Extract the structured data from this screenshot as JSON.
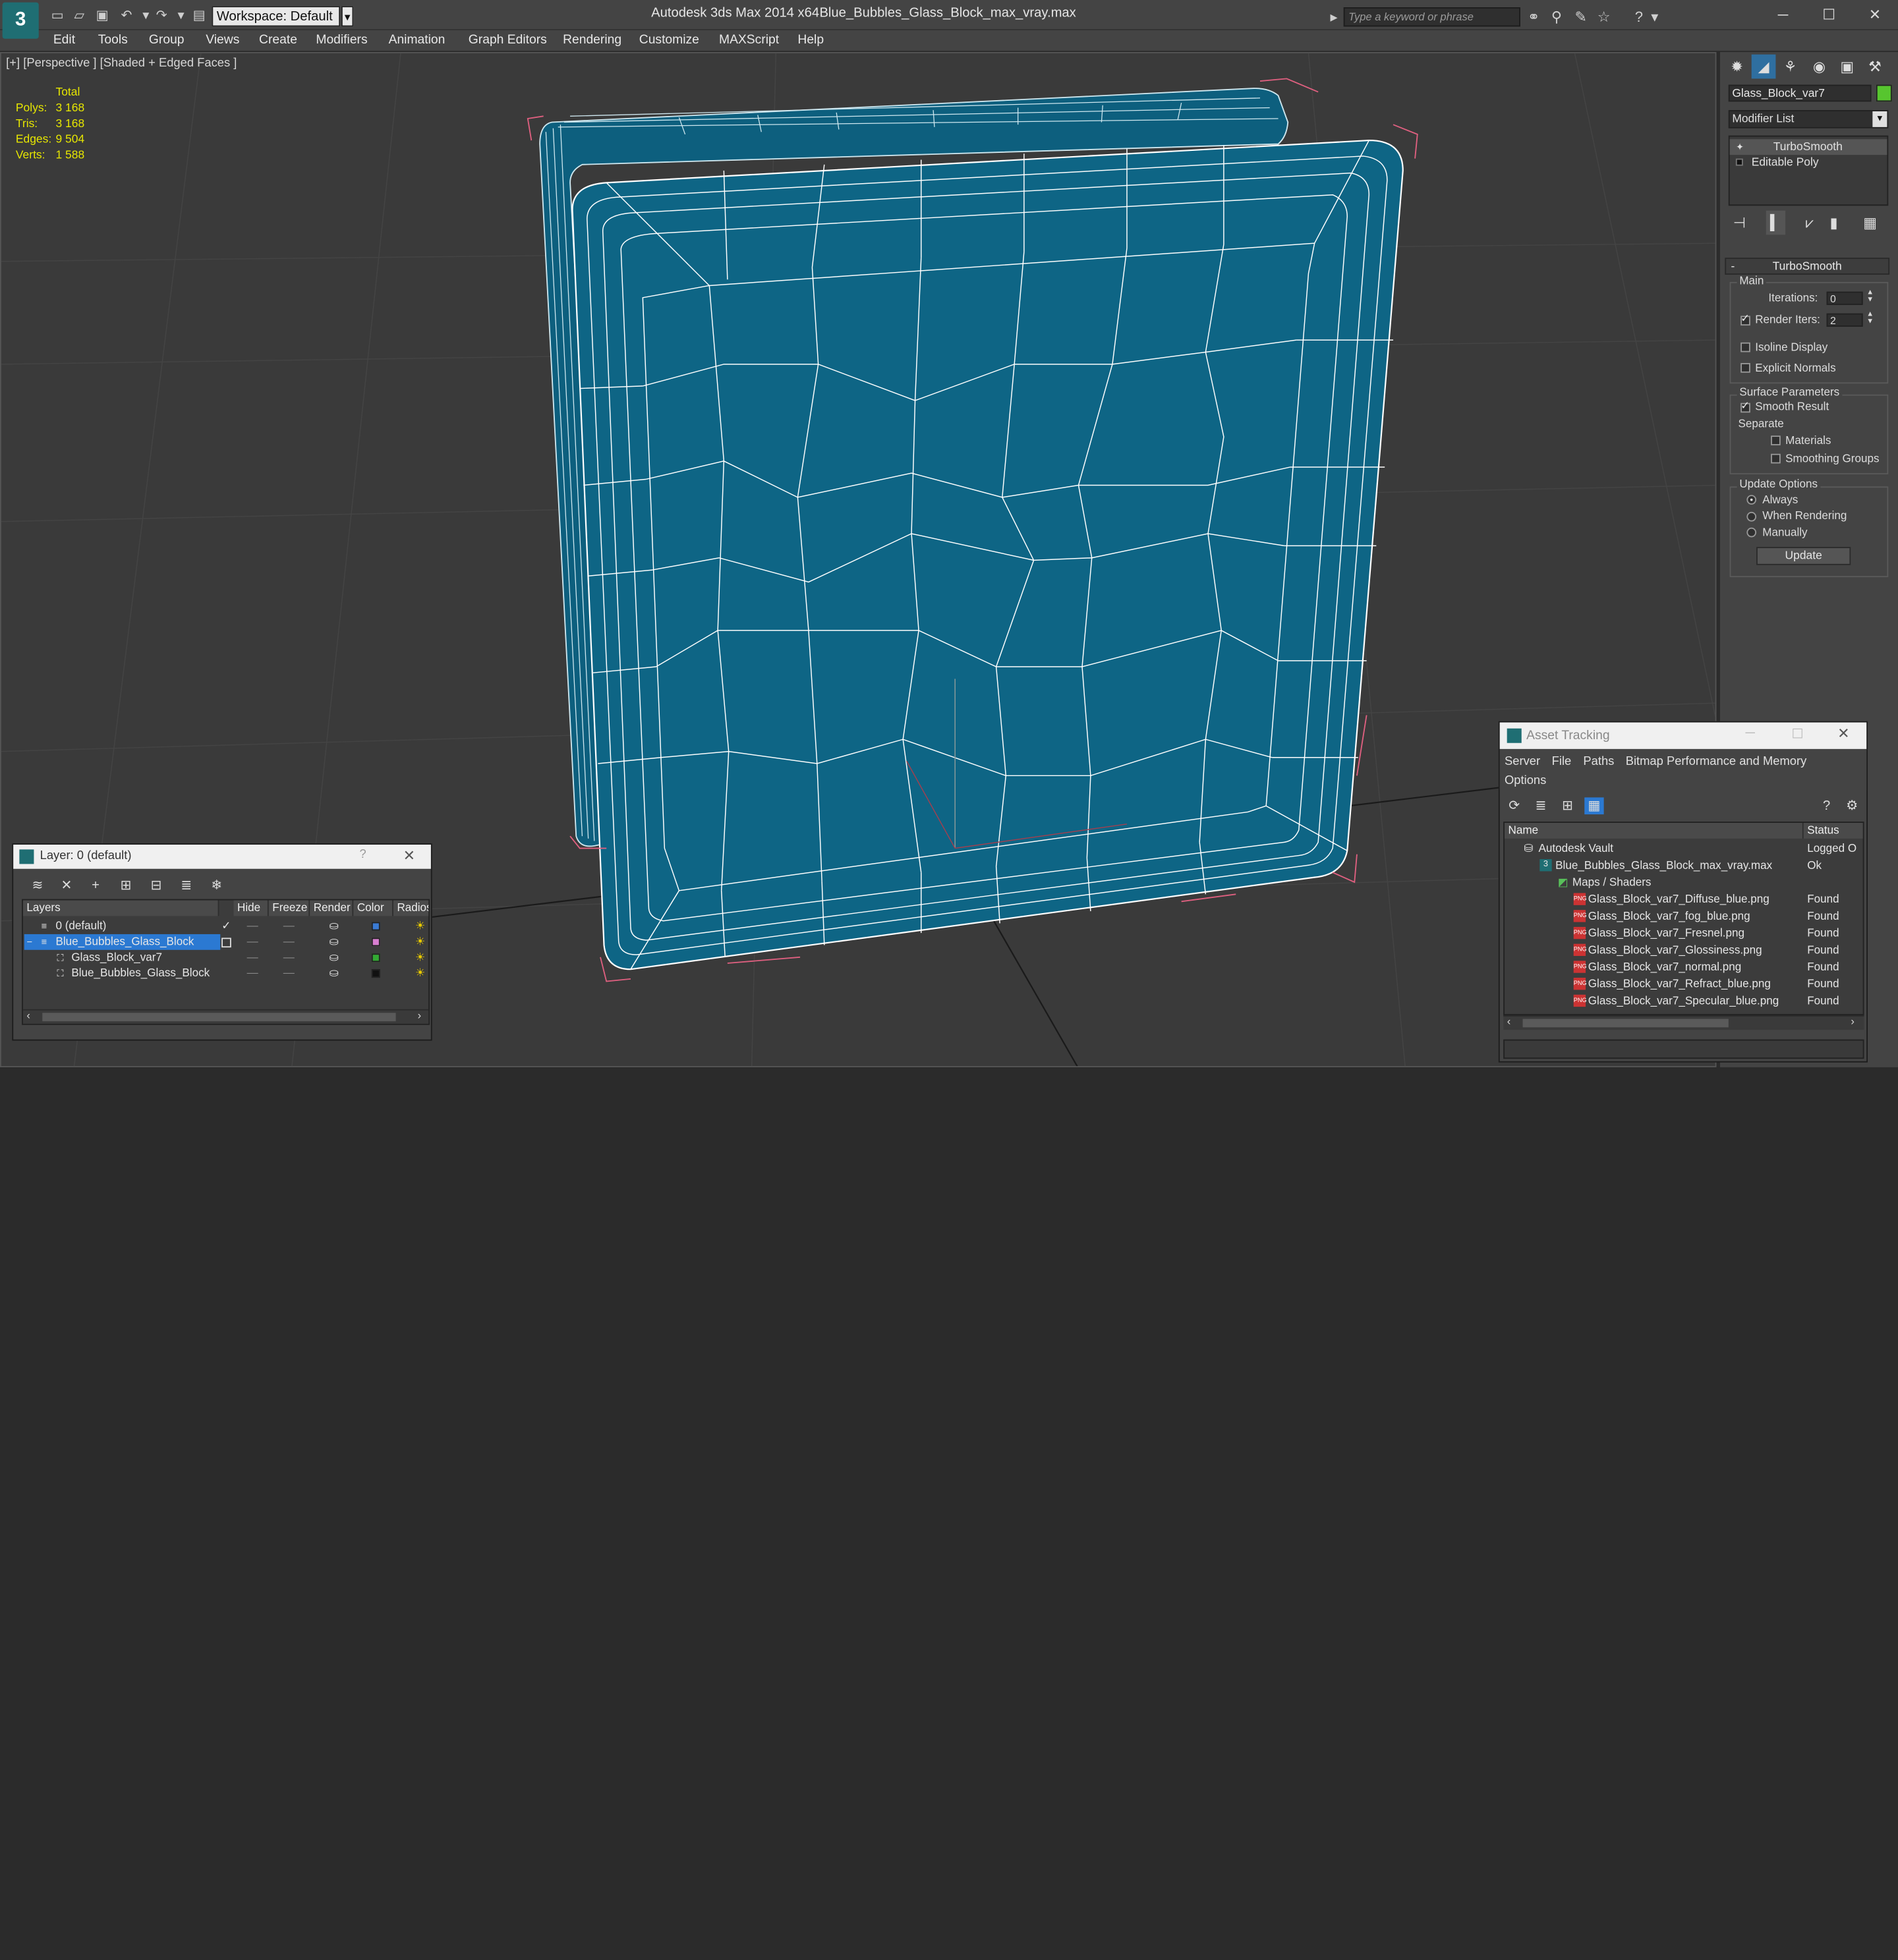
{
  "app": {
    "title": "Autodesk 3ds Max  2014 x64",
    "file": "Blue_Bubbles_Glass_Block_max_vray.max",
    "logo": "3"
  },
  "toolbar": {
    "workspace": "Workspace: Default",
    "search_placeholder": "Type a keyword or phrase"
  },
  "menu": [
    "Edit",
    "Tools",
    "Group",
    "Views",
    "Create",
    "Modifiers",
    "Animation",
    "Graph Editors",
    "Rendering",
    "Customize",
    "MAXScript",
    "Help"
  ],
  "viewport": {
    "label": "[+] [Perspective ] [Shaded + Edged Faces ]",
    "stats": {
      "header": "Total",
      "rows": [
        {
          "label": "Polys:",
          "value": "3 168"
        },
        {
          "label": "Tris:",
          "value": "3 168"
        },
        {
          "label": "Edges:",
          "value": "9 504"
        },
        {
          "label": "Verts:",
          "value": "1 588"
        }
      ]
    }
  },
  "command_panel": {
    "object_name": "Glass_Block_var7",
    "object_color": "#57c52f",
    "modifier_list": "Modifier List",
    "stack": [
      "TurboSmooth",
      "Editable Poly"
    ],
    "rollout_title": "TurboSmooth",
    "main_label": "Main",
    "iterations_label": "Iterations:",
    "iterations_value": "0",
    "render_iters_label": "Render Iters:",
    "render_iters_value": "2",
    "isoline": "Isoline Display",
    "explicit_normals": "Explicit Normals",
    "surface_params": "Surface Parameters",
    "smooth_result": "Smooth Result",
    "separate": "Separate",
    "materials": "Materials",
    "smoothing_groups": "Smoothing Groups",
    "update_options": "Update Options",
    "always": "Always",
    "when_rendering": "When Rendering",
    "manually": "Manually",
    "update_button": "Update"
  },
  "layer_panel": {
    "title": "Layer: 0 (default)",
    "help": "?",
    "columns": [
      "Layers",
      "Hide",
      "Freeze",
      "Render",
      "Color",
      "Radios"
    ],
    "rows": [
      {
        "name": "0 (default)",
        "color": "#3a7bd5"
      },
      {
        "name": "Blue_Bubbles_Glass_Block",
        "color": "#d97fd1"
      },
      {
        "name": "Glass_Block_var7",
        "color": "#33aa33"
      },
      {
        "name": "Blue_Bubbles_Glass_Block",
        "color": "#111111"
      }
    ]
  },
  "asset_tracking": {
    "title": "Asset Tracking",
    "menu": [
      "Server",
      "File",
      "Paths",
      "Bitmap Performance and Memory",
      "Options"
    ],
    "columns": [
      "Name",
      "Status"
    ],
    "rows": [
      {
        "name": "Autodesk Vault",
        "status": "Logged O"
      },
      {
        "name": "Blue_Bubbles_Glass_Block_max_vray.max",
        "status": "Ok"
      },
      {
        "name": "Maps / Shaders",
        "status": ""
      },
      {
        "name": "Glass_Block_var7_Diffuse_blue.png",
        "status": "Found"
      },
      {
        "name": "Glass_Block_var7_fog_blue.png",
        "status": "Found"
      },
      {
        "name": "Glass_Block_var7_Fresnel.png",
        "status": "Found"
      },
      {
        "name": "Glass_Block_var7_Glossiness.png",
        "status": "Found"
      },
      {
        "name": "Glass_Block_var7_normal.png",
        "status": "Found"
      },
      {
        "name": "Glass_Block_var7_Refract_blue.png",
        "status": "Found"
      },
      {
        "name": "Glass_Block_var7_Specular_blue.png",
        "status": "Found"
      }
    ]
  },
  "colors": {
    "mesh_fill": "#0e6585",
    "wire": "#ffffff",
    "selection_bracket": "#e06080",
    "stats_yellow": "#e6e600"
  }
}
